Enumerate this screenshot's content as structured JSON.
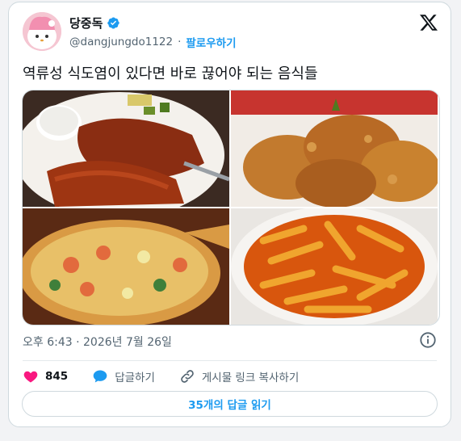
{
  "author": {
    "display_name": "당중독",
    "handle": "@dangjungdo1122",
    "separator": "·",
    "follow_label": "팔로우하기"
  },
  "tweet": {
    "text": "역류성 식도염이 있다면 바로 끊어야 되는 음식들",
    "timestamp": "오후 6:43 · 2026년 7월 26일"
  },
  "media": [
    {
      "name": "돈까스"
    },
    {
      "name": "후라이드 치킨"
    },
    {
      "name": "피자"
    },
    {
      "name": "떡볶이"
    }
  ],
  "actions": {
    "like_count": "845",
    "reply_label": "답글하기",
    "share_label": "게시물 링크 복사하기"
  },
  "replies_button_label": "35개의 답글 읽기",
  "colors": {
    "accent": "#1d9bf0",
    "like": "#f91880",
    "text": "#0f1419",
    "muted": "#536471"
  }
}
